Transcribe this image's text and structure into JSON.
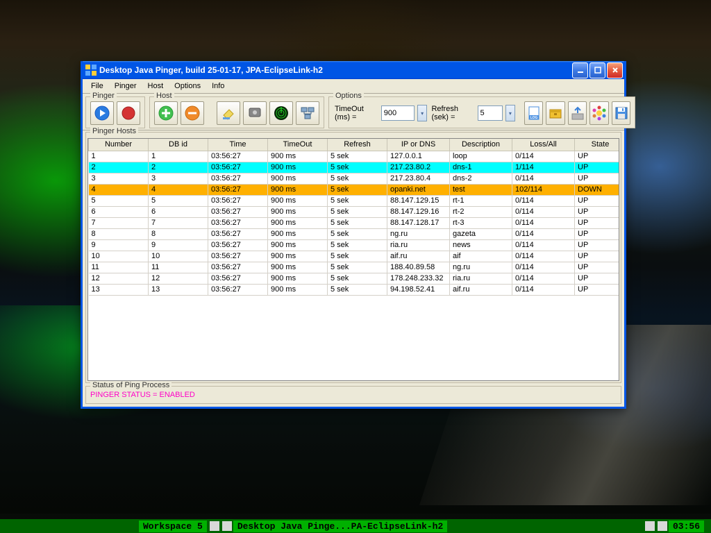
{
  "window": {
    "title": "Desktop Java Pinger, build 25-01-17, JPA-EclipseLink-h2"
  },
  "menu": {
    "file": "File",
    "pinger": "Pinger",
    "host": "Host",
    "options": "Options",
    "info": "Info"
  },
  "groups": {
    "pinger": "Pinger",
    "host": "Host",
    "options": "Options",
    "hosts": "Pinger Hosts",
    "status": "Status of Ping Process"
  },
  "options": {
    "timeout_label": "TimeOut (ms) =",
    "timeout_value": "900",
    "refresh_label": "Refresh (sek) =",
    "refresh_value": "5"
  },
  "columns": [
    "Number",
    "DB id",
    "Time",
    "TimeOut",
    "Refresh",
    "IP or DNS",
    "Description",
    "Loss/All",
    "State"
  ],
  "rows": [
    {
      "hl": "",
      "c": [
        "1",
        "1",
        "03:56:27",
        "900 ms",
        "5 sek",
        "127.0.0.1",
        "loop",
        "0/114",
        "UP"
      ]
    },
    {
      "hl": "cyan",
      "c": [
        "2",
        "2",
        "03:56:27",
        "900 ms",
        "5 sek",
        "217.23.80.2",
        "dns-1",
        "1/114",
        "UP"
      ]
    },
    {
      "hl": "",
      "c": [
        "3",
        "3",
        "03:56:27",
        "900 ms",
        "5 sek",
        "217.23.80.4",
        "dns-2",
        "0/114",
        "UP"
      ]
    },
    {
      "hl": "orange",
      "c": [
        "4",
        "4",
        "03:56:27",
        "900 ms",
        "5 sek",
        "opanki.net",
        "test",
        "102/114",
        "DOWN"
      ]
    },
    {
      "hl": "",
      "c": [
        "5",
        "5",
        "03:56:27",
        "900 ms",
        "5 sek",
        "88.147.129.15",
        "rt-1",
        "0/114",
        "UP"
      ]
    },
    {
      "hl": "",
      "c": [
        "6",
        "6",
        "03:56:27",
        "900 ms",
        "5 sek",
        "88.147.129.16",
        "rt-2",
        "0/114",
        "UP"
      ]
    },
    {
      "hl": "",
      "c": [
        "7",
        "7",
        "03:56:27",
        "900 ms",
        "5 sek",
        "88.147.128.17",
        "rt-3",
        "0/114",
        "UP"
      ]
    },
    {
      "hl": "",
      "c": [
        "8",
        "8",
        "03:56:27",
        "900 ms",
        "5 sek",
        "ng.ru",
        "gazeta",
        "0/114",
        "UP"
      ]
    },
    {
      "hl": "",
      "c": [
        "9",
        "9",
        "03:56:27",
        "900 ms",
        "5 sek",
        "ria.ru",
        "news",
        "0/114",
        "UP"
      ]
    },
    {
      "hl": "",
      "c": [
        "10",
        "10",
        "03:56:27",
        "900 ms",
        "5 sek",
        "aif.ru",
        "aif",
        "0/114",
        "UP"
      ]
    },
    {
      "hl": "",
      "c": [
        "11",
        "11",
        "03:56:27",
        "900 ms",
        "5 sek",
        "188.40.89.58",
        "ng.ru",
        "0/114",
        "UP"
      ]
    },
    {
      "hl": "",
      "c": [
        "12",
        "12",
        "03:56:27",
        "900 ms",
        "5 sek",
        "178.248.233.32",
        "ria.ru",
        "0/114",
        "UP"
      ]
    },
    {
      "hl": "",
      "c": [
        "13",
        "13",
        "03:56:27",
        "900 ms",
        "5 sek",
        "94.198.52.41",
        "aif.ru",
        "0/114",
        "UP"
      ]
    }
  ],
  "status": {
    "text": "PINGER STATUS = ENABLED"
  },
  "taskbar": {
    "workspace": "Workspace 5",
    "app": "Desktop Java Pinge...PA-EclipseLink-h2",
    "clock": "03:56"
  }
}
